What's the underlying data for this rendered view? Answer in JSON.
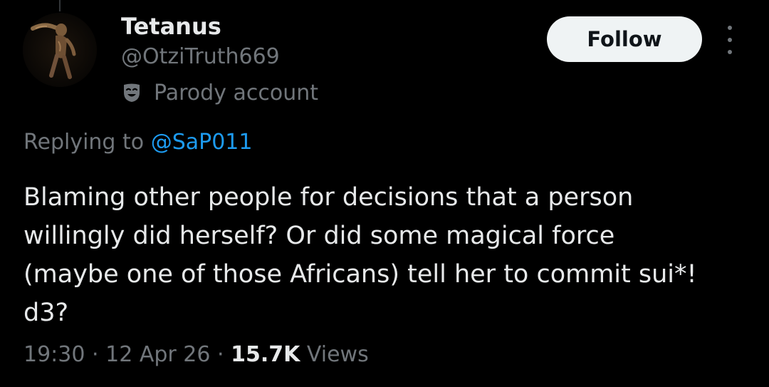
{
  "tweet": {
    "author": {
      "name": "Tetanus",
      "handle": "@OtziTruth669",
      "label": "Parody account"
    },
    "follow_label": "Follow",
    "reply_prefix": "Replying to",
    "reply_to": "@SaP011",
    "text": "Blaming other people for decisions that a person\nwillingly did herself? Or did some magical force\n(maybe one of those Africans) tell her to commit sui*!\nd3?",
    "time": "19:30",
    "date": "12 Apr 26",
    "views_count": "15.7K",
    "views_label": "Views",
    "separator": "·"
  },
  "icons": {
    "avatar": "mummy-avatar-image",
    "parody": "theater-mask-icon",
    "more": "more-options-icon"
  },
  "colors": {
    "background": "#000000",
    "primary_text": "#e7e9ea",
    "secondary_text": "#71767b",
    "link": "#1d9bf0",
    "follow_button_bg": "#eff3f4",
    "follow_button_text": "#0f1419"
  }
}
